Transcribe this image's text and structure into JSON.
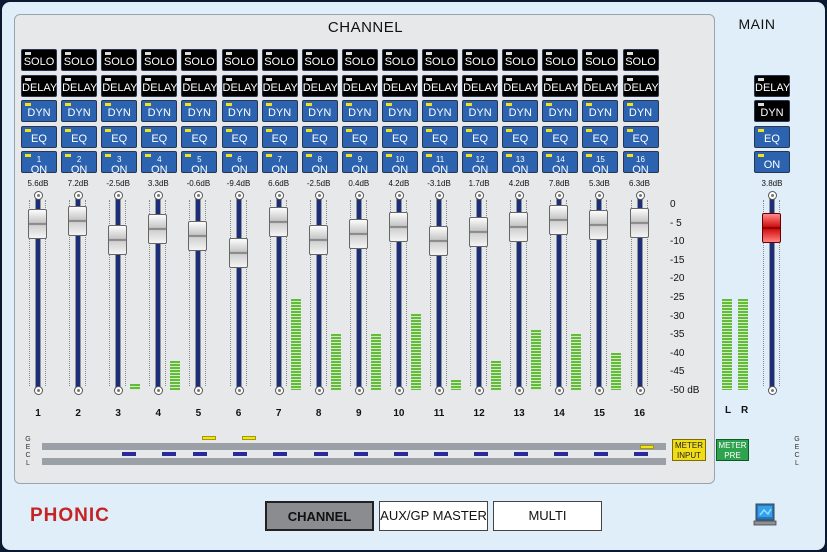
{
  "header": {
    "channel_title": "CHANNEL",
    "main_title": "MAIN"
  },
  "labels": {
    "solo": "SOLO",
    "delay": "DELAY",
    "dyn": "DYN",
    "eq": "EQ",
    "on": "ON"
  },
  "channels": [
    {
      "num": "1",
      "gain": "5.6dB",
      "fader_db": 5.6,
      "meter_level": 0.0
    },
    {
      "num": "2",
      "gain": "7.2dB",
      "fader_db": 7.2,
      "meter_level": 0.0
    },
    {
      "num": "3",
      "gain": "-2.5dB",
      "fader_db": -2.5,
      "meter_level": 0.03
    },
    {
      "num": "4",
      "gain": "3.3dB",
      "fader_db": 3.3,
      "meter_level": 0.15
    },
    {
      "num": "5",
      "gain": "-0.6dB",
      "fader_db": -0.6,
      "meter_level": 0.0
    },
    {
      "num": "6",
      "gain": "-9.4dB",
      "fader_db": -9.4,
      "meter_level": 0.0
    },
    {
      "num": "7",
      "gain": "6.6dB",
      "fader_db": 6.6,
      "meter_level": 0.47
    },
    {
      "num": "8",
      "gain": "-2.5dB",
      "fader_db": -2.5,
      "meter_level": 0.29
    },
    {
      "num": "9",
      "gain": "0.4dB",
      "fader_db": 0.4,
      "meter_level": 0.29
    },
    {
      "num": "10",
      "gain": "4.2dB",
      "fader_db": 4.2,
      "meter_level": 0.39
    },
    {
      "num": "11",
      "gain": "-3.1dB",
      "fader_db": -3.1,
      "meter_level": 0.05
    },
    {
      "num": "12",
      "gain": "1.7dB",
      "fader_db": 1.7,
      "meter_level": 0.15
    },
    {
      "num": "13",
      "gain": "4.2dB",
      "fader_db": 4.2,
      "meter_level": 0.31
    },
    {
      "num": "14",
      "gain": "7.8dB",
      "fader_db": 7.8,
      "meter_level": 0.29
    },
    {
      "num": "15",
      "gain": "5.3dB",
      "fader_db": 5.3,
      "meter_level": 0.19
    },
    {
      "num": "16",
      "gain": "6.3dB",
      "fader_db": 6.3,
      "meter_level": 0.0
    }
  ],
  "main": {
    "gain": "3.8dB",
    "fader_db": 3.8,
    "meter_l": 0.47,
    "meter_r": 0.47,
    "l_label": "L",
    "r_label": "R"
  },
  "scale": [
    "0",
    "- 5",
    "-10",
    "-15",
    "-20",
    "-25",
    "-30",
    "-35",
    "-40",
    "-45",
    "-50 dB"
  ],
  "gecl": "GECL",
  "buttons": {
    "meter_input": "METER INPUT",
    "meter_pre": "METER PRE"
  },
  "tabs": [
    {
      "label": "CHANNEL",
      "active": true
    },
    {
      "label": "AUX/GP MASTER",
      "active": false
    },
    {
      "label": "MULTI",
      "active": false
    }
  ],
  "brand": "PHONIC",
  "colors": {
    "button_blue": "#2b63b0",
    "meter_green": "#63bb3a",
    "track_blue": "#1d2d78",
    "main_fader_red": "#d30f0f",
    "brand_red": "#c42424"
  }
}
